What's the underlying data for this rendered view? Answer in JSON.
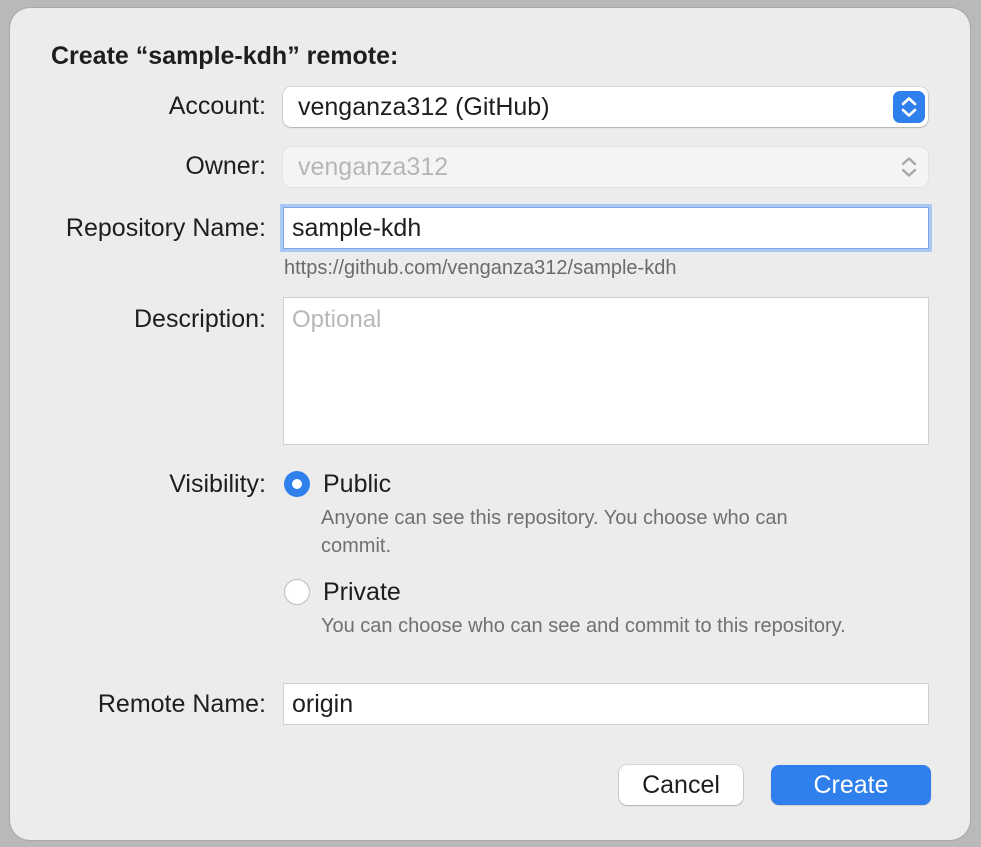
{
  "dialog": {
    "title": "Create “sample-kdh” remote:",
    "account": {
      "label": "Account:",
      "value": "venganza312 (GitHub)"
    },
    "owner": {
      "label": "Owner:",
      "value": "venganza312"
    },
    "repository": {
      "label": "Repository Name:",
      "value": "sample-kdh",
      "url": "https://github.com/venganza312/sample-kdh"
    },
    "description": {
      "label": "Description:",
      "placeholder": "Optional",
      "value": ""
    },
    "visibility": {
      "label": "Visibility:",
      "selected": "Public",
      "options": [
        {
          "label": "Public",
          "description": "Anyone can see this repository. You choose who can commit."
        },
        {
          "label": "Private",
          "description": "You can choose who can see and commit to this repository."
        }
      ]
    },
    "remote": {
      "label": "Remote Name:",
      "value": "origin"
    },
    "buttons": {
      "cancel": "Cancel",
      "create": "Create"
    }
  },
  "colors": {
    "accent": "#2f80ed",
    "background": "#ececec",
    "secondary_text": "#707070",
    "placeholder": "#b8b8b8"
  },
  "icons": {
    "popup": "up-down-chevron-icon"
  }
}
